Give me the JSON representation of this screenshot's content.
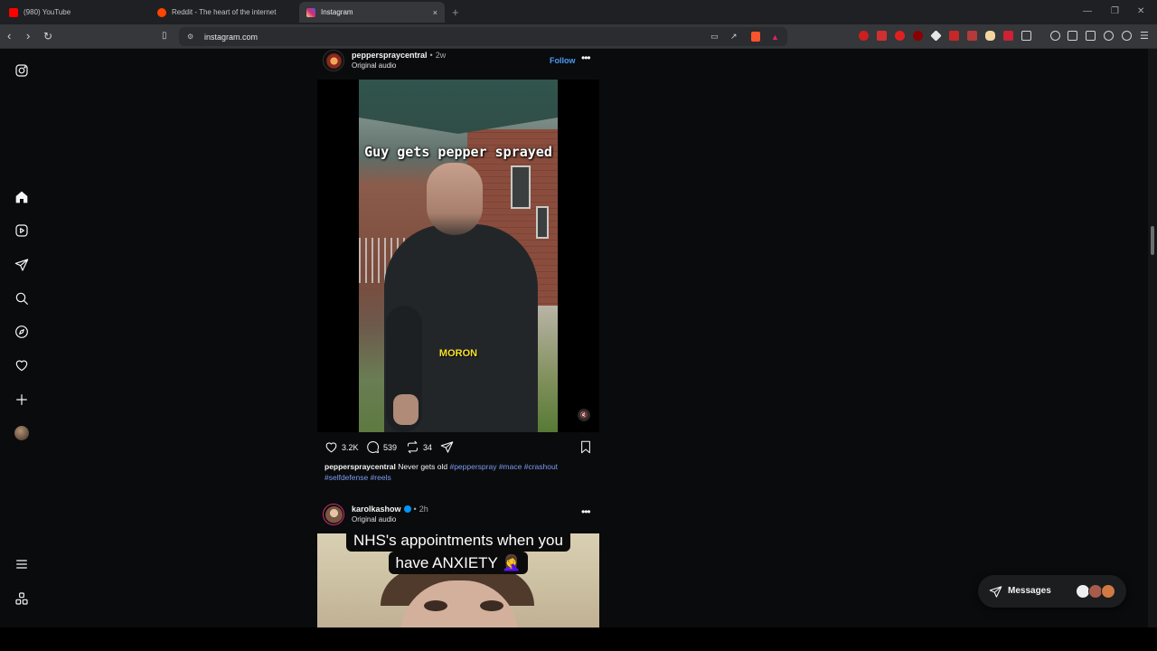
{
  "browser": {
    "tabs": [
      {
        "title": "(980) YouTube",
        "favicon_color": "#ff0000"
      },
      {
        "title": "Reddit - The heart of the internet",
        "favicon_color": "#ff4500"
      },
      {
        "title": "Instagram",
        "favicon_color": "#d62976",
        "active": true
      }
    ],
    "tab_close": "×",
    "new_tab": "+",
    "url": "instagram.com",
    "window_controls": [
      "—",
      "❐",
      "✕"
    ]
  },
  "sidenav": {
    "icons": [
      "instagram-logo-icon",
      "home-icon",
      "reels-icon",
      "direct-icon",
      "search-icon",
      "explore-icon",
      "heart-icon",
      "create-icon",
      "profile-avatar",
      "menu-icon",
      "more-apps-icon"
    ]
  },
  "post1": {
    "username": "pepperspraycentral",
    "separator": "•",
    "time": "2w",
    "audio": "Original audio",
    "follow": "Follow",
    "more": "•••",
    "video_caption_top": "Guy gets pepper sprayed",
    "video_caption_bottom": "MORON",
    "sound_icon": "🔇",
    "likes": "3.2K",
    "comments": "539",
    "reposts": "34",
    "caption_username": "pepperspraycentral",
    "caption_text": "Never gets old",
    "hashtags": [
      "#pepperspray",
      "#mace",
      "#crashout",
      "#selfdefense",
      "#reels"
    ]
  },
  "post2": {
    "username": "karolkashow",
    "separator": "•",
    "time": "2h",
    "audio": "Original audio",
    "more": "•••",
    "overlay_line1": "NHS's appointments when you",
    "overlay_line2": "have ANXIETY 🤦‍♀️"
  },
  "messages": {
    "label": "Messages"
  },
  "colors": {
    "link": "#7b9cf3",
    "follow": "#4a9cf8",
    "page_bg": "#0a0b0c",
    "caption_yellow": "#f7e12b"
  }
}
